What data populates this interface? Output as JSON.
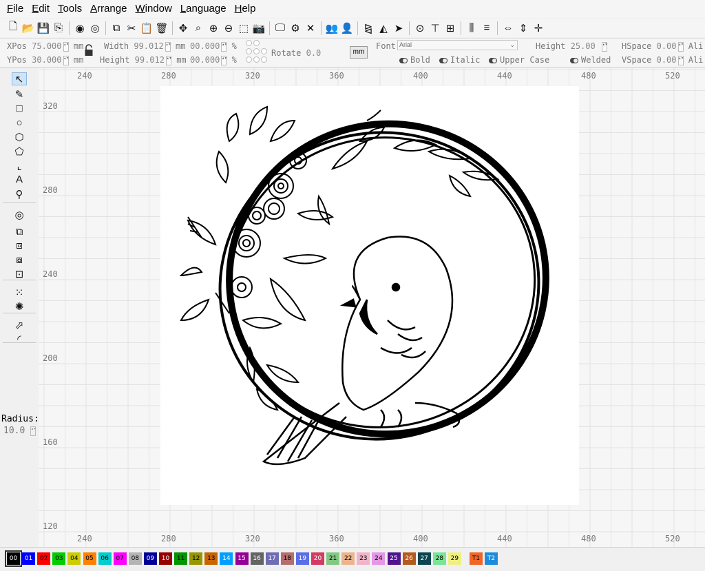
{
  "menu": [
    "File",
    "Edit",
    "Tools",
    "Arrange",
    "Window",
    "Language",
    "Help"
  ],
  "menu_underline": [
    "F",
    "E",
    "T",
    "A",
    "W",
    "L",
    "H"
  ],
  "toolbar_icons": [
    "new-file-icon",
    "open-folder-icon",
    "save-icon",
    "export-icon",
    "sep",
    "circle-tool-icon",
    "refresh-icon",
    "sep",
    "copy-icon",
    "cut-icon",
    "paste-icon",
    "delete-icon",
    "sep",
    "move-icon",
    "zoom-icon",
    "zoom-in-icon",
    "zoom-out-icon",
    "select-box-icon",
    "camera-icon",
    "sep",
    "monitor-icon",
    "settings-icon",
    "tools-icon",
    "sep",
    "group-icon",
    "user-icon",
    "sep",
    "mirror-icon",
    "flip-icon",
    "send-icon",
    "sep",
    "center-icon",
    "align-icon",
    "distribute-icon",
    "sep",
    "align-v-icon",
    "align-h-icon",
    "sep",
    "spacing-icon",
    "equal-icon",
    "gap-icon"
  ],
  "props": {
    "xpos_label": "XPos",
    "xpos": "75.000",
    "xpos_unit": "mm",
    "ypos_label": "YPos",
    "ypos": "30.000",
    "ypos_unit": "mm",
    "width_label": "Width",
    "width": "99.012",
    "width_unit": "mm",
    "height_label": "Height",
    "height": "99.012",
    "height_unit": "mm",
    "scale_x": "00.000",
    "scale_x_unit": "%",
    "scale_y": "00.000",
    "scale_y_unit": "%",
    "rotate_label": "Rotate",
    "rotate": "0.0",
    "unit_button": "mm",
    "font_label": "Font",
    "font_value": "Arial",
    "font_height_label": "Height",
    "font_height": "25.00",
    "hspace_label": "HSpace",
    "hspace": "0.00",
    "vspace_label": "VSpace",
    "vspace": "0.00",
    "align_label": "Ali",
    "bold": "Bold",
    "italic": "Italic",
    "upper_case": "Upper Case",
    "welded": "Welded"
  },
  "left_tools": [
    "select-pointer-icon",
    "pen-icon",
    "rectangle-icon",
    "ellipse-icon",
    "polygon-icon",
    "star-icon",
    "corner-rect-icon",
    "text-tool-icon",
    "location-pin-icon",
    "offset-icon",
    "union-icon",
    "subtract-icon",
    "intersect-icon",
    "exclude-icon",
    "array-icon",
    "circular-array-icon",
    "node-edit-icon",
    "round-corner-icon"
  ],
  "radius_label": "Radius:",
  "radius_value": "10.0",
  "ruler_x": [
    "240",
    "280",
    "320",
    "360",
    "400",
    "440",
    "480",
    "520"
  ],
  "ruler_y": [
    "320",
    "280",
    "240",
    "200",
    "160",
    "120"
  ],
  "layers": [
    {
      "label": "00",
      "color": "#000000",
      "text": "#ffffff"
    },
    {
      "label": "01",
      "color": "#0000ff",
      "text": "#ffffff"
    },
    {
      "label": "02",
      "color": "#ff0000",
      "text": "#000000"
    },
    {
      "label": "03",
      "color": "#00cc00",
      "text": "#000000"
    },
    {
      "label": "04",
      "color": "#cccc00",
      "text": "#000000"
    },
    {
      "label": "05",
      "color": "#ff8000",
      "text": "#000000"
    },
    {
      "label": "06",
      "color": "#00cccc",
      "text": "#000000"
    },
    {
      "label": "07",
      "color": "#ff00ff",
      "text": "#000000"
    },
    {
      "label": "08",
      "color": "#b4b4b4",
      "text": "#000000"
    },
    {
      "label": "09",
      "color": "#000096",
      "text": "#ffffff"
    },
    {
      "label": "10",
      "color": "#960000",
      "text": "#ffffff"
    },
    {
      "label": "11",
      "color": "#009600",
      "text": "#000000"
    },
    {
      "label": "12",
      "color": "#969600",
      "text": "#000000"
    },
    {
      "label": "13",
      "color": "#c86400",
      "text": "#000000"
    },
    {
      "label": "14",
      "color": "#00a0ff",
      "text": "#ffffff"
    },
    {
      "label": "15",
      "color": "#960096",
      "text": "#ffffff"
    },
    {
      "label": "16",
      "color": "#646464",
      "text": "#ffffff"
    },
    {
      "label": "17",
      "color": "#6e6eb4",
      "text": "#ffffff"
    },
    {
      "label": "18",
      "color": "#b46e6e",
      "text": "#000000"
    },
    {
      "label": "19",
      "color": "#5a6ee6",
      "text": "#ffffff"
    },
    {
      "label": "20",
      "color": "#d23c64",
      "text": "#ffffff"
    },
    {
      "label": "21",
      "color": "#82c882",
      "text": "#000000"
    },
    {
      "label": "22",
      "color": "#ebb48c",
      "text": "#000000"
    },
    {
      "label": "23",
      "color": "#f0b4c8",
      "text": "#000000"
    },
    {
      "label": "24",
      "color": "#e696e6",
      "text": "#000000"
    },
    {
      "label": "25",
      "color": "#50148c",
      "text": "#ffffff"
    },
    {
      "label": "26",
      "color": "#b45a1e",
      "text": "#ffffff"
    },
    {
      "label": "27",
      "color": "#0a4650",
      "text": "#ffffff"
    },
    {
      "label": "28",
      "color": "#78e696",
      "text": "#000000"
    },
    {
      "label": "29",
      "color": "#f0f082",
      "text": "#000000"
    },
    {
      "label": "T1",
      "color": "#f06428",
      "text": "#000000"
    },
    {
      "label": "T2",
      "color": "#1e8cdc",
      "text": "#ffffff"
    }
  ]
}
